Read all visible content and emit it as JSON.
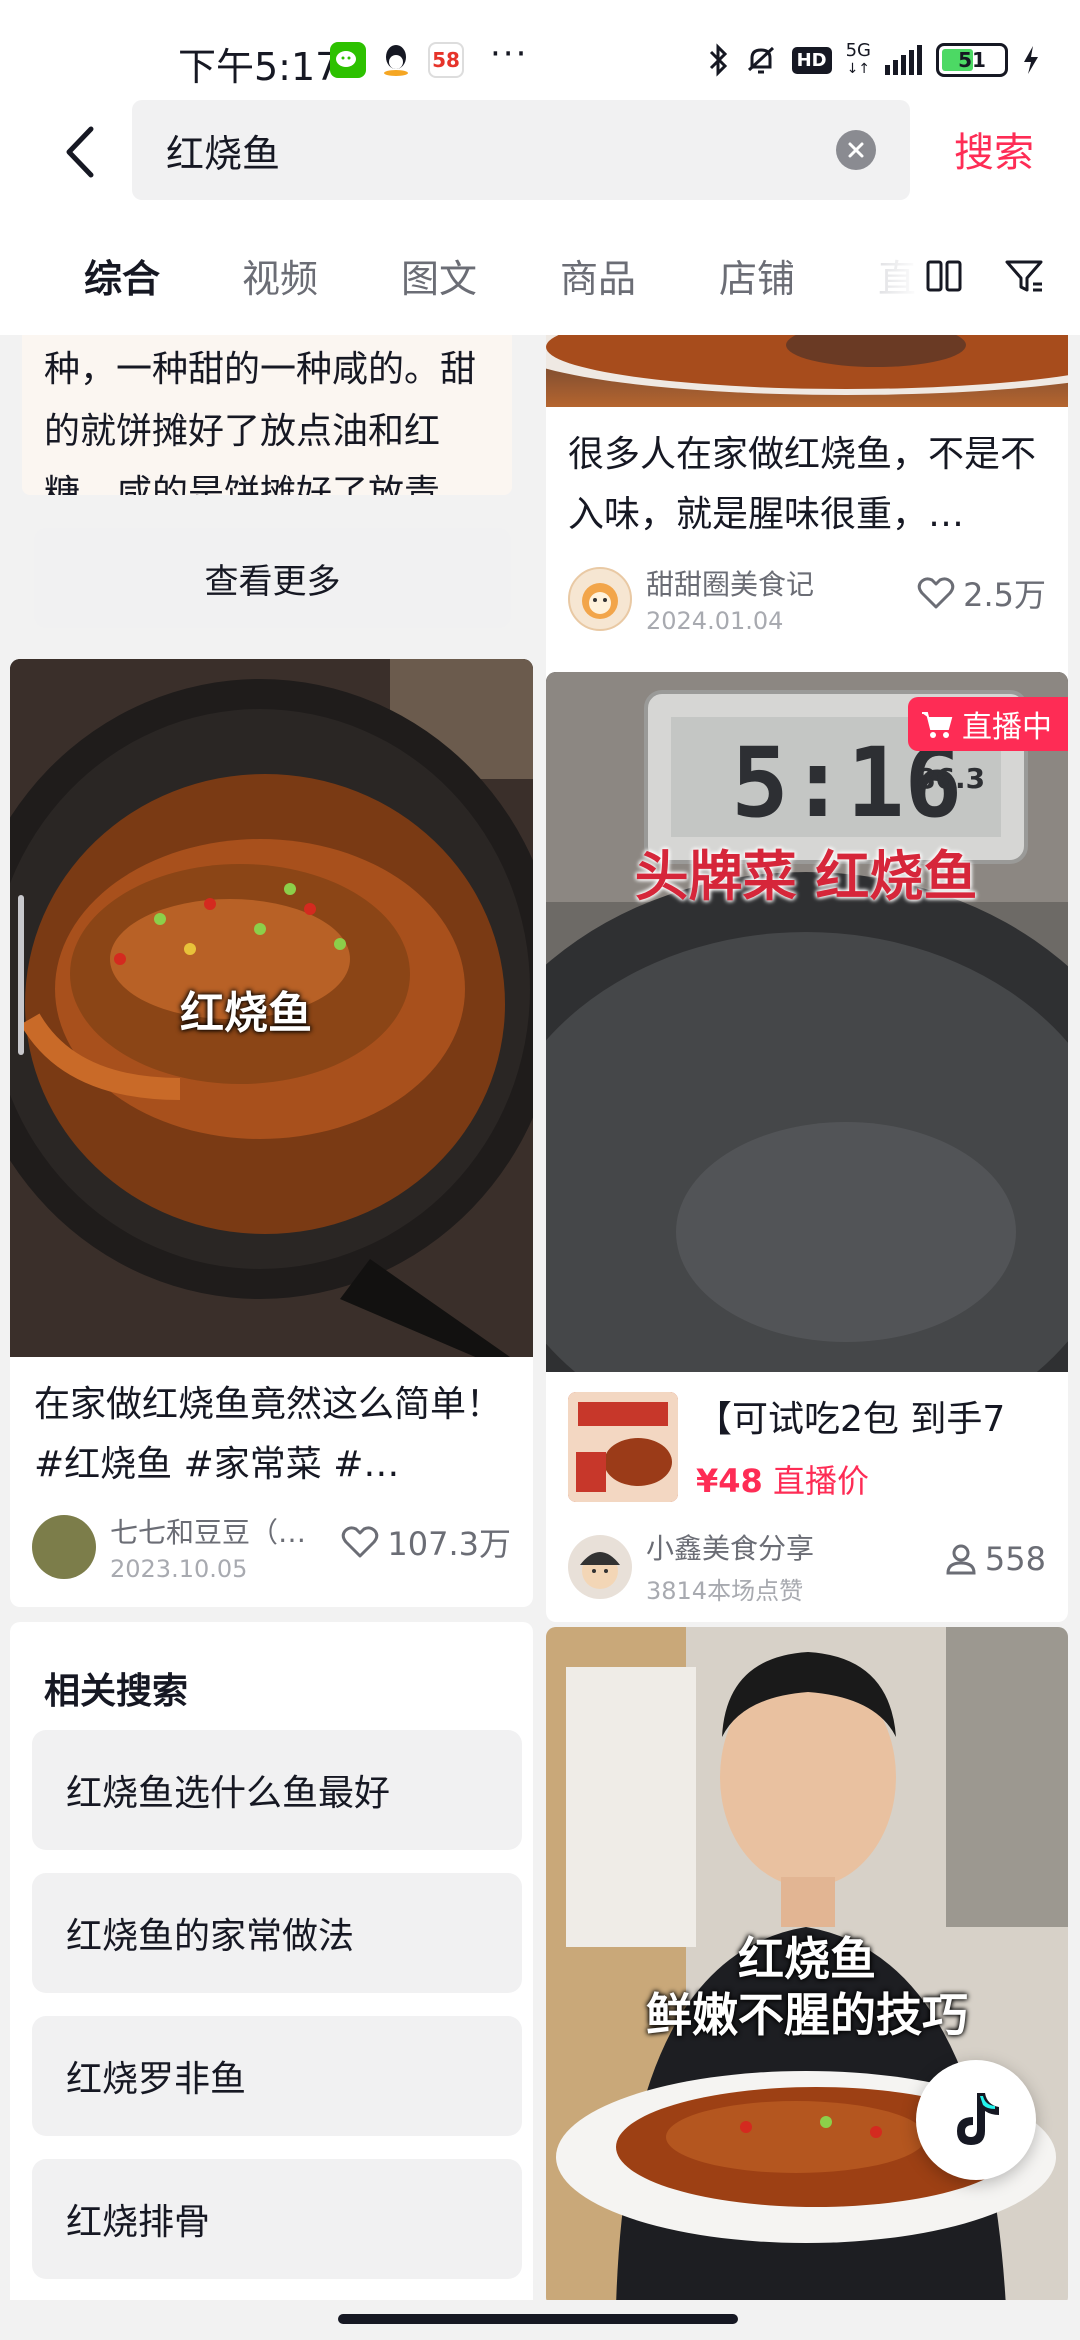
{
  "status_bar": {
    "time": "下午5:17",
    "app_icons": [
      "wechat-icon",
      "qq-icon",
      "58-icon"
    ],
    "more": "···",
    "network": "5G",
    "battery": "51"
  },
  "search": {
    "query": "红烧鱼",
    "submit_label": "搜索"
  },
  "tabs": [
    "综合",
    "视频",
    "图文",
    "商品",
    "店铺",
    "直"
  ],
  "feed": {
    "left_top_snippet": "种，一种甜的一种咸的。甜的就饼摊好了放点油和红糖，咸的是饼摊好了放青…",
    "view_more_label": "查看更多",
    "right_top": {
      "title": "很多人在家做红烧鱼，不是不入味，就是腥味很重，…",
      "author": "甜甜圈美食记",
      "date": "2024.01.04",
      "likes": "2.5万"
    },
    "left_video": {
      "overlay": "红烧鱼",
      "title": "在家做红烧鱼竟然这么简单！#红烧鱼 #家常菜 #…",
      "author": "七七和豆豆（…",
      "date": "2023.10.05",
      "likes": "107.3万"
    },
    "live_card": {
      "badge": "直播中",
      "clock_time": "5:16",
      "clock_small": "86.3",
      "overlay": "头牌菜 红烧鱼",
      "product_title": "【可试吃2包 到手7",
      "price": "¥48",
      "price_label": "直播价",
      "author": "小鑫美食分享",
      "sub": "3814本场点赞",
      "viewers": "558"
    },
    "related": {
      "title": "相关搜索",
      "items": [
        "红烧鱼选什么鱼最好",
        "红烧鱼的家常做法",
        "红烧罗非鱼",
        "红烧排骨"
      ]
    },
    "bottom_right_video": {
      "overlay_line1": "红烧鱼",
      "overlay_line2": "鲜嫩不腥的技巧"
    }
  },
  "colors": {
    "accent": "#fe2c55",
    "text": "#161823",
    "muted": "#6b6d75"
  }
}
